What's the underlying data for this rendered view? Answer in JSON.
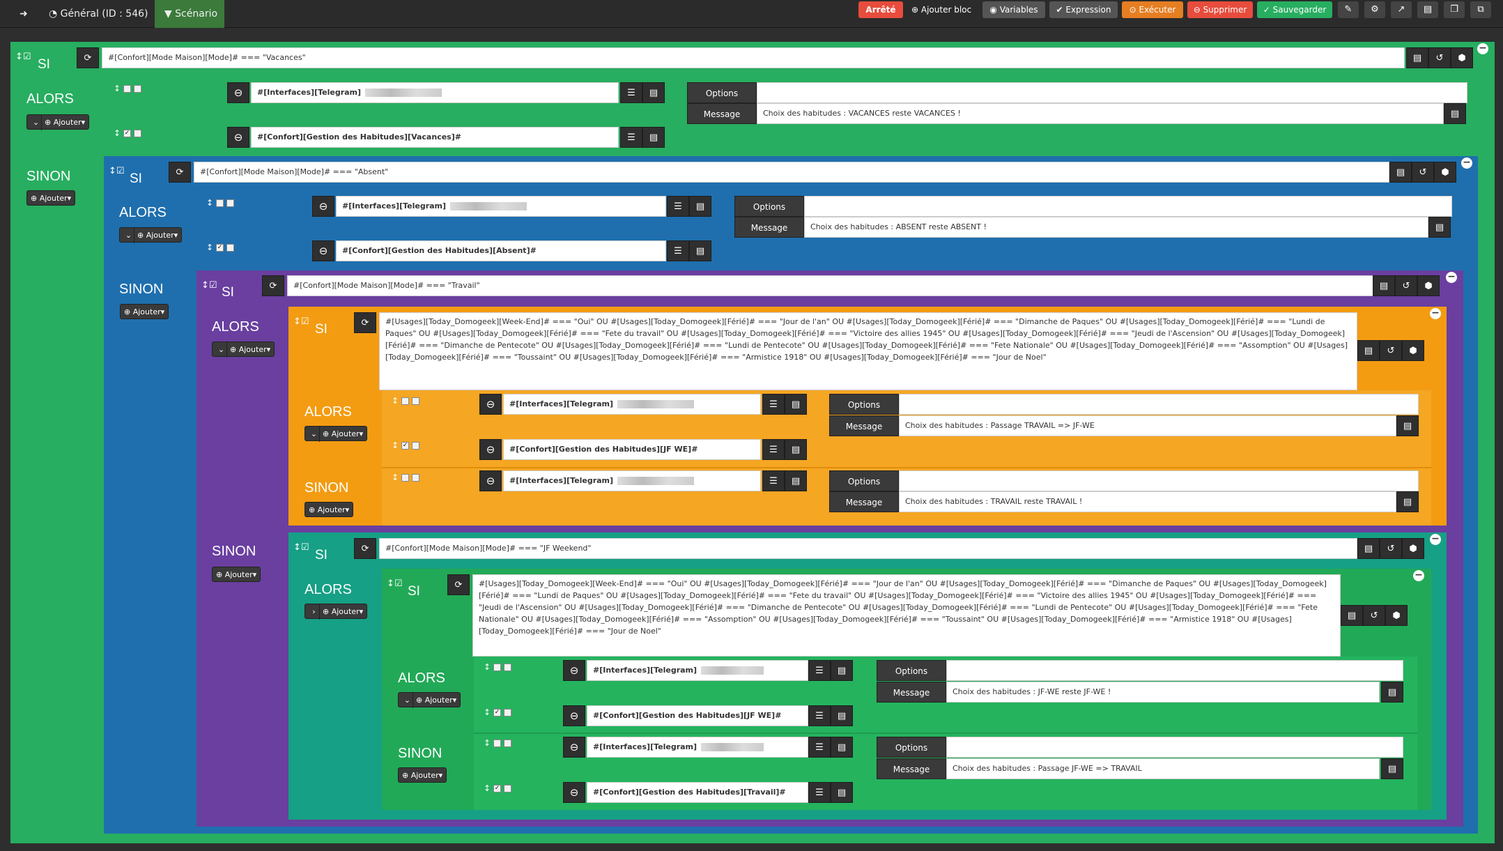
{
  "topbar": {
    "back": "⮐",
    "general": "Général (ID : 546)",
    "scenario": "Scénario",
    "status": "Arrêté",
    "add_block": "Ajouter bloc",
    "variables": "Variables",
    "expression": "Expression",
    "executer": "Exécuter",
    "supprimer": "Supprimer",
    "sauvegarder": "Sauvegarder"
  },
  "colors": {
    "green": "#27ae60",
    "blue": "#1f6fae",
    "purple": "#6a3fa0",
    "orange": "#f39c12",
    "dgreen": "#16a085",
    "mgreen": "#22a957"
  },
  "labels": {
    "si": "SI",
    "alors": "ALORS",
    "sinon": "SINON",
    "ajouter": "Ajouter",
    "options": "Options",
    "message": "Message"
  },
  "b1": {
    "cond": "#[Confort][Mode Maison][Mode]# === \"Vacances\"",
    "cmd1": "#[Interfaces][Telegram]",
    "msg1": "Choix des habitudes : VACANCES reste VACANCES !",
    "cmd2": "#[Confort][Gestion des Habitudes][Vacances]#"
  },
  "b2": {
    "cond": "#[Confort][Mode Maison][Mode]# === \"Absent\"",
    "cmd1": "#[Interfaces][Telegram]",
    "msg1": "Choix des habitudes : ABSENT reste ABSENT !",
    "cmd2": "#[Confort][Gestion des Habitudes][Absent]#"
  },
  "b3": {
    "cond": "#[Confort][Mode Maison][Mode]# === \"Travail\""
  },
  "b4": {
    "cond": "#[Usages][Today_Domogeek][Week-End]# === \"Oui\" OU #[Usages][Today_Domogeek][Férié]# === \"Jour de l'an\" OU #[Usages][Today_Domogeek][Férié]# === \"Dimanche de Paques\" OU #[Usages][Today_Domogeek][Férié]# === \"Lundi de Paques\" OU #[Usages][Today_Domogeek][Férié]# === \"Fete du travail\" OU #[Usages][Today_Domogeek][Férié]# === \"Victoire des allies 1945\" OU #[Usages][Today_Domogeek][Férié]# === \"Jeudi de l'Ascension\" OU #[Usages][Today_Domogeek][Férié]# === \"Dimanche de Pentecote\" OU #[Usages][Today_Domogeek][Férié]# === \"Lundi de Pentecote\" OU #[Usages][Today_Domogeek][Férié]# === \"Fete Nationale\" OU #[Usages][Today_Domogeek][Férié]# === \"Assomption\" OU #[Usages][Today_Domogeek][Férié]# === \"Toussaint\" OU #[Usages][Today_Domogeek][Férié]# === \"Armistice 1918\" OU #[Usages][Today_Domogeek][Férié]# === \"Jour de Noel\"",
    "cmd1": "#[Interfaces][Telegram]",
    "msg1": "Choix des habitudes : Passage TRAVAIL => JF-WE",
    "cmd2": "#[Confort][Gestion des Habitudes][JF WE]#",
    "cmd3": "#[Interfaces][Telegram]",
    "msg3": "Choix des habitudes : TRAVAIL reste TRAVAIL !"
  },
  "b5": {
    "cond": "#[Confort][Mode Maison][Mode]# === \"JF Weekend\""
  },
  "b6": {
    "cond": "#[Usages][Today_Domogeek][Week-End]# === \"Oui\" OU #[Usages][Today_Domogeek][Férié]# === \"Jour de l'an\" OU #[Usages][Today_Domogeek][Férié]# === \"Dimanche de Paques\" OU #[Usages][Today_Domogeek][Férié]# === \"Lundi de Paques\" OU #[Usages][Today_Domogeek][Férié]# === \"Fete du travail\" OU #[Usages][Today_Domogeek][Férié]# === \"Victoire des allies 1945\" OU #[Usages][Today_Domogeek][Férié]# === \"Jeudi de l'Ascension\" OU #[Usages][Today_Domogeek][Férié]# === \"Dimanche de Pentecote\" OU #[Usages][Today_Domogeek][Férié]# === \"Lundi de Pentecote\" OU #[Usages][Today_Domogeek][Férié]# === \"Fete Nationale\" OU #[Usages][Today_Domogeek][Férié]# === \"Assomption\" OU #[Usages][Today_Domogeek][Férié]# === \"Toussaint\" OU #[Usages][Today_Domogeek][Férié]# === \"Armistice 1918\" OU #[Usages][Today_Domogeek][Férié]# === \"Jour de Noel\"",
    "cmd1": "#[Interfaces][Telegram]",
    "msg1": "Choix des habitudes : JF-WE reste JF-WE !",
    "cmd2": "#[Confort][Gestion des Habitudes][JF WE]#",
    "cmd3": "#[Interfaces][Telegram]",
    "msg3": "Choix des habitudes : Passage JF-WE => TRAVAIL",
    "cmd4": "#[Confort][Gestion des Habitudes][Travail]#"
  }
}
